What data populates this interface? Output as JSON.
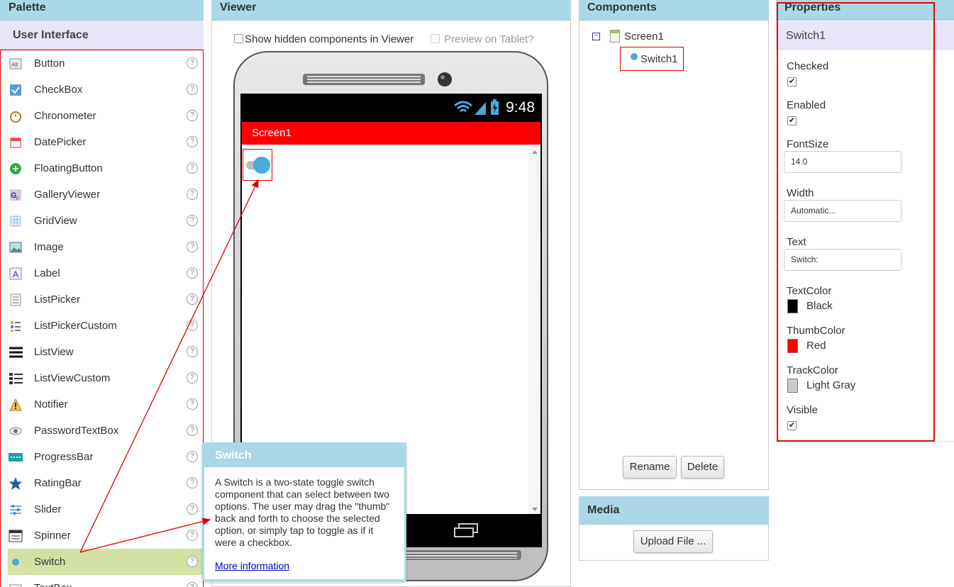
{
  "palette": {
    "title": "Palette",
    "section": "User Interface",
    "help_glyph": "?",
    "items": [
      {
        "label": "Button",
        "icon": "button-icon"
      },
      {
        "label": "CheckBox",
        "icon": "checkbox-icon"
      },
      {
        "label": "Chronometer",
        "icon": "chronometer-icon"
      },
      {
        "label": "DatePicker",
        "icon": "datepicker-icon"
      },
      {
        "label": "FloatingButton",
        "icon": "floatingbutton-icon"
      },
      {
        "label": "GalleryViewer",
        "icon": "galleryviewer-icon"
      },
      {
        "label": "GridView",
        "icon": "gridview-icon"
      },
      {
        "label": "Image",
        "icon": "image-icon"
      },
      {
        "label": "Label",
        "icon": "label-icon"
      },
      {
        "label": "ListPicker",
        "icon": "listpicker-icon"
      },
      {
        "label": "ListPickerCustom",
        "icon": "listpickercustom-icon"
      },
      {
        "label": "ListView",
        "icon": "listview-icon"
      },
      {
        "label": "ListViewCustom",
        "icon": "listviewcustom-icon"
      },
      {
        "label": "Notifier",
        "icon": "notifier-icon"
      },
      {
        "label": "PasswordTextBox",
        "icon": "passwordtextbox-icon"
      },
      {
        "label": "ProgressBar",
        "icon": "progressbar-icon"
      },
      {
        "label": "RatingBar",
        "icon": "ratingbar-icon"
      },
      {
        "label": "Slider",
        "icon": "slider-icon"
      },
      {
        "label": "Spinner",
        "icon": "spinner-icon"
      },
      {
        "label": "Switch",
        "icon": "switch-icon"
      },
      {
        "label": "TextBox",
        "icon": "textbox-icon"
      }
    ]
  },
  "viewer": {
    "title": "Viewer",
    "show_hidden": "Show hidden components in Viewer",
    "preview_tablet": "Preview on Tablet?",
    "status_time": "9:48",
    "screen_title": "Screen1"
  },
  "tooltip": {
    "title": "Switch",
    "body": "A Switch is a two-state toggle switch component that can select between two options. The user may drag the \"thumb\" back and forth to choose the selected option, or simply tap to toggle as if it were a checkbox.",
    "link": "More information"
  },
  "components": {
    "title": "Components",
    "tree": [
      "Screen1",
      "Switch1"
    ],
    "rename": "Rename",
    "delete": "Delete"
  },
  "media": {
    "title": "Media",
    "upload": "Upload File ..."
  },
  "properties": {
    "title": "Properties",
    "component": "Switch1",
    "checked_label": "Checked",
    "checked": true,
    "enabled_label": "Enabled",
    "enabled": true,
    "fontsize_label": "FontSize",
    "fontsize": "14.0",
    "width_label": "Width",
    "width": "Automatic...",
    "text_label": "Text",
    "text": "Switch:",
    "textcolor_label": "TextColor",
    "textcolor": "Black",
    "textcolor_hex": "#000000",
    "thumbcolor_label": "ThumbColor",
    "thumbcolor": "Red",
    "thumbcolor_hex": "#ff0000",
    "trackcolor_label": "TrackColor",
    "trackcolor": "Light Gray",
    "trackcolor_hex": "#cccccc",
    "visible_label": "Visible",
    "visible": true
  },
  "colors": {
    "panel_header": "#aad8e6",
    "annotation": "#dd0000",
    "selected_item": "#d3e2a4"
  }
}
